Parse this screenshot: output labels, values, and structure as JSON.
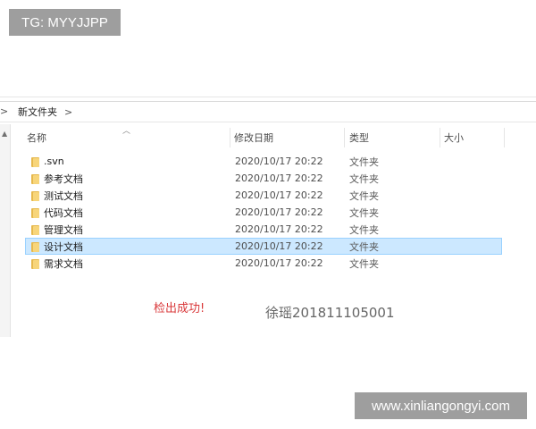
{
  "watermarks": {
    "top_left": "TG: MYYJJPP",
    "bottom_right": "www.xinliangongyi.com"
  },
  "address_bar": {
    "lead_glyph": ">",
    "path": "新文件夹",
    "separator": ">"
  },
  "columns": {
    "name": "名称",
    "modified": "修改日期",
    "type": "类型",
    "size": "大小"
  },
  "files": [
    {
      "name": ".svn",
      "modified": "2020/10/17 20:22",
      "type": "文件夹",
      "selected": false
    },
    {
      "name": "参考文档",
      "modified": "2020/10/17 20:22",
      "type": "文件夹",
      "selected": false
    },
    {
      "name": "测试文档",
      "modified": "2020/10/17 20:22",
      "type": "文件夹",
      "selected": false
    },
    {
      "name": "代码文档",
      "modified": "2020/10/17 20:22",
      "type": "文件夹",
      "selected": false
    },
    {
      "name": "管理文档",
      "modified": "2020/10/17 20:22",
      "type": "文件夹",
      "selected": false
    },
    {
      "name": "设计文档",
      "modified": "2020/10/17 20:22",
      "type": "文件夹",
      "selected": true
    },
    {
      "name": "需求文档",
      "modified": "2020/10/17 20:22",
      "type": "文件夹",
      "selected": false
    }
  ],
  "messages": {
    "checkout_success": "检出成功!",
    "author": "徐瑶201811105001"
  },
  "colors": {
    "selection_bg": "#cce8ff",
    "selection_border": "#99d1ff",
    "success_text": "#d9383a",
    "folder": "#f7d57a",
    "watermark_bg": "#9e9e9e"
  }
}
